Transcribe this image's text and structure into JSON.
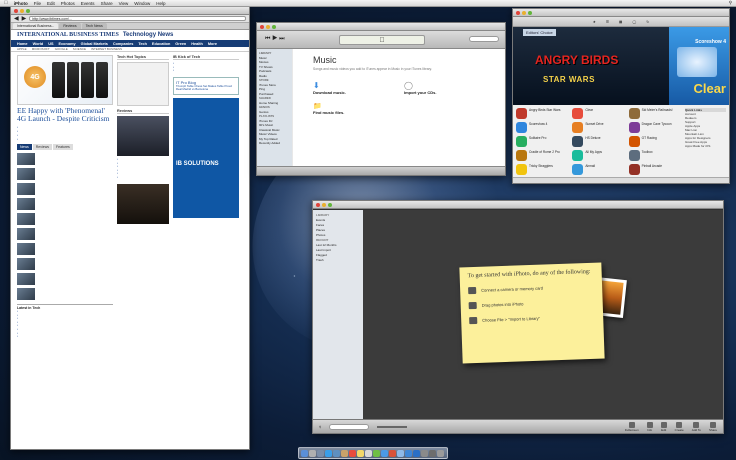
{
  "menubar": {
    "apple": "",
    "app": "iPhoto",
    "items": [
      "File",
      "Edit",
      "Photos",
      "Events",
      "Share",
      "View",
      "Window",
      "Help"
    ]
  },
  "safari": {
    "tabs": [
      "International Business...",
      "Reviews",
      "Tech News"
    ],
    "address": "http://www.ibtimes.com/...",
    "logo": "INTERNATIONAL BUSINESS TIMES",
    "section": "Technology News",
    "nav": [
      "Home",
      "World",
      "US",
      "Economy",
      "Global Markets",
      "Companies",
      "Tech",
      "Education",
      "Green",
      "Health",
      "More"
    ],
    "subnav": [
      "APPLE",
      "MICROSOFT",
      "GOOGLE",
      "SCIENCE",
      "INTERNET BUSINESS"
    ],
    "hero_badge": "4G",
    "headline": "EE Happy with 'Phenomenal' 4G Launch - Despite Criticism",
    "tabs3": [
      "News",
      "Reviews",
      "Features"
    ],
    "sidebar_title1": "Tech Hot Topics",
    "sidebar_title2": "IB Kick of Tech",
    "reviews_title": "Reviews",
    "blog_header": "IT Pro Blog",
    "blog_link": "Triumph Table Chess Set Makes Table Proud",
    "blog_link2": "Real Madrid vs Barcelona",
    "latest_title": "Latest in Tech",
    "ad_text": "IB SOLUTIONS"
  },
  "itunes": {
    "lcd": "",
    "title": "Music",
    "intro": "Songs and music videos you add to iTunes appear in Music in your iTunes library.",
    "col1_title": "Download music.",
    "col2_title": "Import your CDs.",
    "find_title": "Find music files.",
    "sidebar": [
      "LIBRARY",
      "Music",
      "Movies",
      "TV Shows",
      "Podcasts",
      "Radio",
      "STORE",
      "iTunes Store",
      "Ping",
      "Purchased",
      "SHARED",
      "Home Sharing",
      "GENIUS",
      "Genius",
      "PLAYLISTS",
      "iTunes DJ",
      "90's Music",
      "Classical Music",
      "Music Videos",
      "My Top Rated",
      "Recently Added",
      "Recently Played",
      "Top 25 Most Played"
    ]
  },
  "appstore": {
    "editors_choice": "Editors' Choice",
    "banner_title": "ANGRY BIRDS",
    "banner_sub": "STAR WARS",
    "side_title": "Scoreshow 4",
    "side_promo": "Clear",
    "apps": [
      "Angry Birds Star Wars",
      "Clear",
      "Sid Meier's Railroads!",
      "Scoreshow 4",
      "Sunset Drive",
      "Dragon Cave Tycoon",
      "Solitaire Pro",
      "HS Deluxe",
      "GT Racing",
      "Cradle of Rome 2 Pro",
      "All My Apps",
      "Toolbox",
      "Tricky Stragglers",
      "Airmail",
      "Pinball Arcade"
    ],
    "side_list_title": "Quick Links",
    "side_list": [
      "Account",
      "Redeem",
      "Support",
      "Apple Apps",
      "Mac Lion",
      "Mountain Lion",
      "Apps for Designers",
      "Great Free Apps",
      "Apps Made for iOS"
    ]
  },
  "iphoto": {
    "sidebar": [
      "LIBRARY",
      "Events",
      "Faces",
      "Places",
      "Photos",
      "RECENT",
      "Last 12 Months",
      "Last Import",
      "Flagged",
      "Trash"
    ],
    "note_title": "To get started with iPhoto, do any of the following:",
    "note_rows": [
      "Connect a camera or memory card",
      "Drag photos into iPhoto",
      "Choose File > \"Import to Library\""
    ],
    "toolbar": [
      "Fullscreen",
      "Info",
      "Edit",
      "Create",
      "Add To",
      "Share"
    ]
  }
}
